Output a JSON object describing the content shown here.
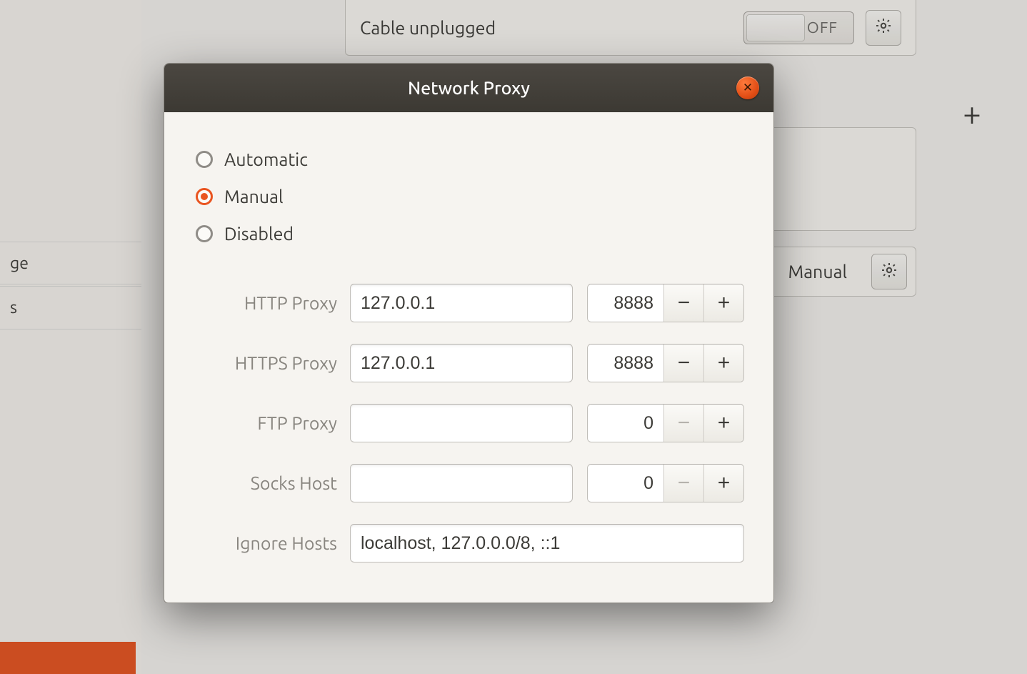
{
  "page": {
    "sidebar": {
      "row1": "ge",
      "row2": "s"
    },
    "wired": {
      "label": "Cable unplugged",
      "switch": "OFF",
      "mode_label": "Manual"
    },
    "plus_icon": "+"
  },
  "dialog": {
    "title": "Network Proxy",
    "close_glyph": "✕",
    "radios": {
      "auto": "Automatic",
      "manual": "Manual",
      "disabled": "Disabled",
      "selected": "manual"
    },
    "labels": {
      "http": "HTTP Proxy",
      "https": "HTTPS Proxy",
      "ftp": "FTP Proxy",
      "socks": "Socks Host",
      "ignore": "Ignore Hosts"
    },
    "values": {
      "http_host": "127.0.0.1",
      "http_port": "8888",
      "https_host": "127.0.0.1",
      "https_port": "8888",
      "ftp_host": "",
      "ftp_port": "0",
      "socks_host": "",
      "socks_port": "0",
      "ignore": "localhost, 127.0.0.0/8, ::1"
    },
    "buttons": {
      "minus": "−",
      "plus": "+"
    }
  }
}
